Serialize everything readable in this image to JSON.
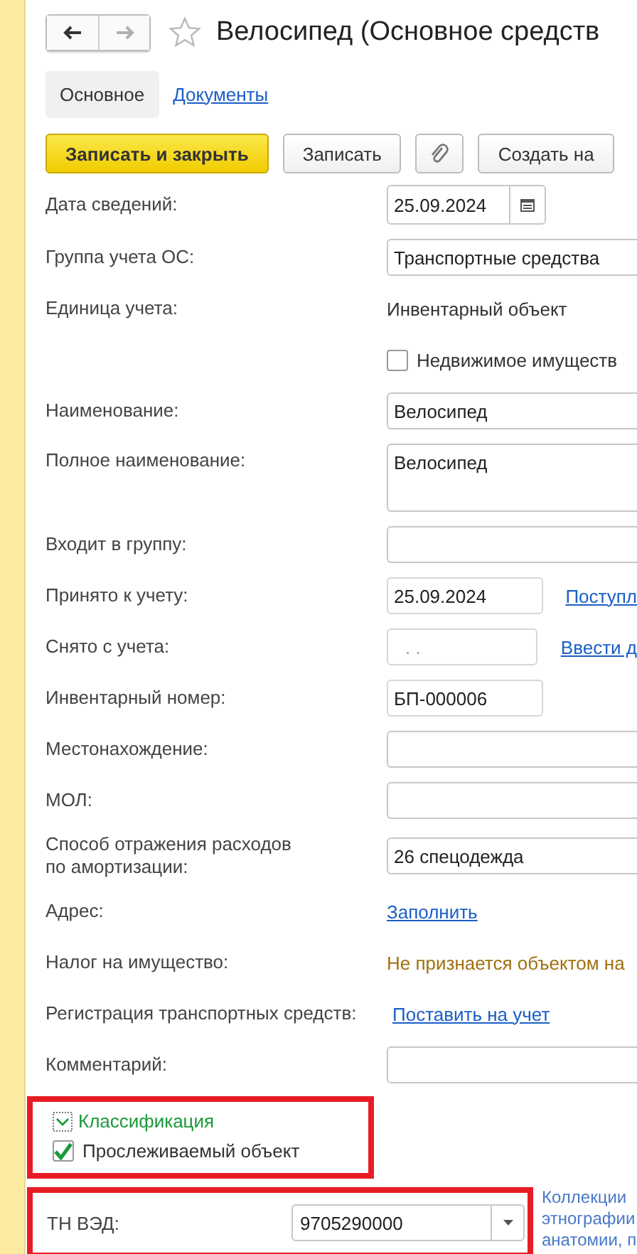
{
  "nav": [
    {
      "kind": "back",
      "disabled": false
    },
    {
      "kind": "forward",
      "disabled": true
    }
  ],
  "favorite": false,
  "title": "Велосипед (Основное средств",
  "tabs": [
    {
      "label": "Основное",
      "selected": true
    },
    {
      "label": "Документы",
      "selected": false
    }
  ],
  "toolbar": [
    {
      "kind": "primary",
      "label": "Записать и закрыть"
    },
    {
      "kind": "button",
      "label": "Записать"
    },
    {
      "kind": "attach"
    },
    {
      "kind": "button",
      "label": "Создать на"
    }
  ],
  "fields": [
    {
      "kind": "date",
      "label": "Дата сведений:",
      "value": "25.09.2024"
    },
    {
      "kind": "input",
      "label": "Группа учета ОС:",
      "value": "Транспортные средства"
    },
    {
      "kind": "text",
      "label": "Единица учета:",
      "value": "Инвентарный объект"
    },
    {
      "kind": "checkbox",
      "text": "Недвижимое имуществ",
      "checked": false
    },
    {
      "kind": "input",
      "label": "Наименование:",
      "value": "Велосипед"
    },
    {
      "kind": "textarea",
      "label": "Полное наименование:",
      "value": "Велосипед"
    },
    {
      "kind": "input",
      "label": "Входит в группу:"
    },
    {
      "kind": "short",
      "label": "Принято к учету:",
      "value": "25.09.2024",
      "link": "Поступл"
    },
    {
      "kind": "short",
      "label": "Снято с учета:",
      "placeholder": ". .",
      "link": "Ввести д"
    },
    {
      "kind": "short",
      "label": "Инвентарный номер:",
      "value": "БП-000006"
    },
    {
      "kind": "input",
      "label": "Местонахождение:"
    },
    {
      "kind": "input",
      "label": "МОЛ:"
    },
    {
      "kind": "input",
      "label": "Способ отражения расходов по амортизации:",
      "value": "26 спецодежда"
    },
    {
      "kind": "link",
      "label": "Адрес:",
      "link": "Заполнить"
    },
    {
      "kind": "note",
      "label": "Налог на имущество:",
      "value": "Не признается объектом на"
    },
    {
      "kind": "inline-link",
      "label": "Регистрация транспортных средств:",
      "link": "Поставить на учет"
    },
    {
      "kind": "input",
      "label": "Комментарий:"
    }
  ],
  "classification": {
    "title": "Классификация",
    "expanded": true,
    "highlighted": true,
    "checkbox": {
      "text": "Прослеживаемый объект",
      "checked": true
    }
  },
  "tnved": {
    "label": "ТН ВЭД:",
    "value": "9705290000",
    "highlighted": true,
    "description": [
      "Коллекции",
      "этнографии",
      "анатомии, п"
    ]
  }
}
